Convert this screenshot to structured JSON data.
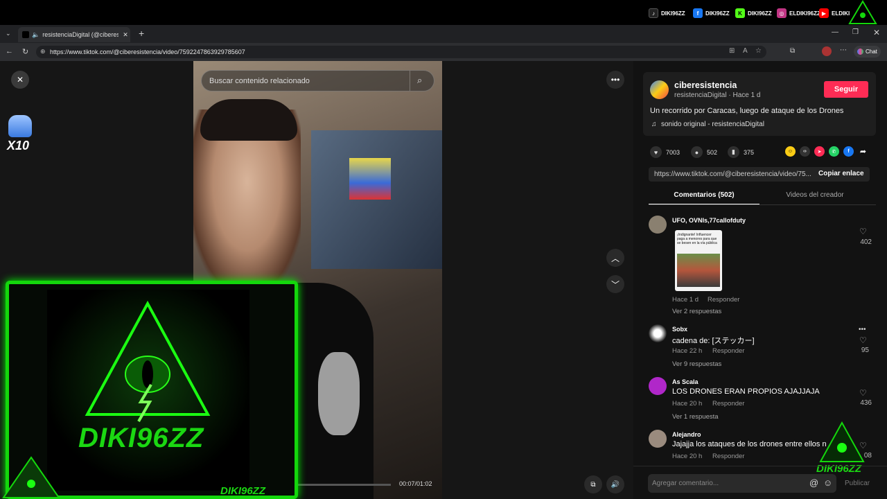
{
  "social": [
    {
      "icon": "tiktok-icon",
      "label": "DIKI96ZZ",
      "color": "#111111"
    },
    {
      "icon": "facebook-icon",
      "label": "DIKI96ZZ",
      "color": "#1877f2"
    },
    {
      "icon": "kick-icon",
      "label": "DIKI96ZZ",
      "color": "#53fc18"
    },
    {
      "icon": "instagram-icon",
      "label": "ELDIKI96ZZ",
      "color": "#c13584"
    },
    {
      "icon": "youtube-icon",
      "label": "ELDIKI",
      "color": "#ff0000"
    }
  ],
  "browser": {
    "tab_title": "resistenciaDigital (@ciberesist",
    "url": "https://www.tiktok.com/@ciberesistencia/video/7592247863929785607",
    "chat_label": "Chat"
  },
  "player": {
    "search_placeholder": "Buscar contenido relacionado",
    "time": "00:07/01:02",
    "x10_label": "X10",
    "brand": "DIKI96ZZ"
  },
  "post": {
    "author": "ciberesistencia",
    "handle_time": "resistenciaDigital · Hace 1 d",
    "follow_label": "Seguir",
    "caption": "Un recorrido por Caracas, luego de ataque de los Drones",
    "sound": "sonido original - resistenciaDigital",
    "likes": "7003",
    "comments": "502",
    "saves": "375",
    "link": "https://www.tiktok.com/@ciberesistencia/video/75...",
    "copy_label": "Copiar enlace"
  },
  "tabs": [
    {
      "label": "Comentarios (502)"
    },
    {
      "label": "Videos del creador"
    }
  ],
  "comments": [
    {
      "name": "UFO, OVNIs,77callofduty",
      "image_text": "¡Indignante! Influencer paga a menores para que se besen en la vía pública",
      "meta": "Hace 1 d",
      "reply": "Responder",
      "replies": "Ver 2 respuestas",
      "likes": "402"
    },
    {
      "name": "Sobx",
      "text": "cadena de: [ステッカー]",
      "meta": "Hace 22 h",
      "reply": "Responder",
      "replies": "Ver 9 respuestas",
      "likes": "95"
    },
    {
      "name": "As Scala",
      "text": "LOS DRONES ERAN PROPIOS AJAJJAJA",
      "meta": "Hace 20 h",
      "reply": "Responder",
      "replies": "Ver 1 respuesta",
      "likes": "436"
    },
    {
      "name": "Alejandro",
      "text": "Jajajja los ataques de los drones entre ellos n",
      "meta": "Hace 20 h",
      "reply": "Responder",
      "likes": "08"
    }
  ],
  "composer": {
    "placeholder": "Agregar comentario...",
    "publish": "Publicar"
  },
  "colors": {
    "accent": "#fe2c55",
    "neon": "#14d70c"
  }
}
